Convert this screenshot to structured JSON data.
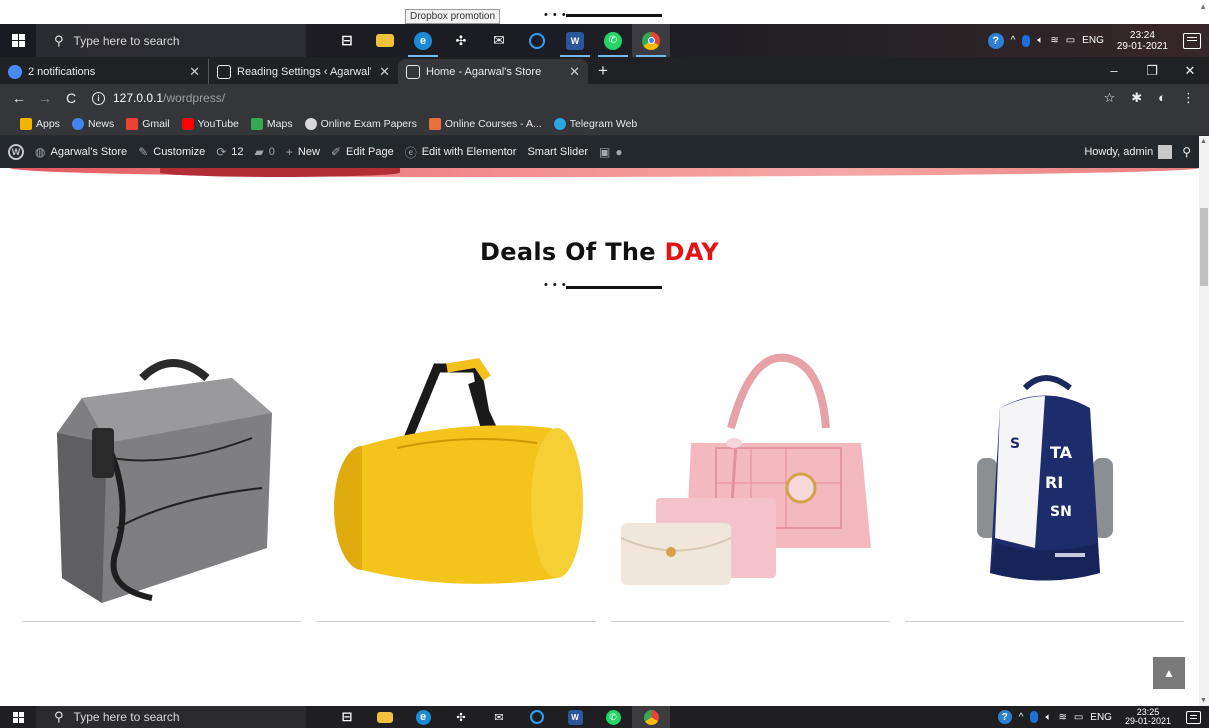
{
  "tooltip": "Dropbox promotion",
  "taskbar_top": {
    "search_placeholder": "Type here to search",
    "lang": "ENG",
    "time": "23:24",
    "date": "29-01-2021"
  },
  "taskbar_bottom": {
    "search_placeholder": "Type here to search",
    "lang": "ENG",
    "time": "23:25",
    "date": "29-01-2021"
  },
  "taskbar_apps": [
    {
      "name": "task-view",
      "glyph": "⧉",
      "color": "transparent"
    },
    {
      "name": "file-explorer",
      "glyph": "▬",
      "color": "#f0c23c"
    },
    {
      "name": "edge",
      "glyph": "e",
      "color": "#1c8bd6"
    },
    {
      "name": "dropbox",
      "glyph": "◆",
      "color": "transparent"
    },
    {
      "name": "mail",
      "glyph": "✉",
      "color": "transparent"
    },
    {
      "name": "cortana",
      "glyph": "○",
      "color": "transparent"
    },
    {
      "name": "word",
      "glyph": "W",
      "color": "#2b579a"
    },
    {
      "name": "whatsapp",
      "glyph": "✆",
      "color": "#25d366"
    },
    {
      "name": "chrome",
      "glyph": "●",
      "color": "#f5b400"
    }
  ],
  "tabs": [
    {
      "title": "2 notifications",
      "fav_color": "#4a8cf7"
    },
    {
      "title": "Reading Settings ‹ Agarwal's Stor",
      "fav_color": "#e8eaed"
    },
    {
      "title": "Home - Agarwal's Store",
      "fav_color": "#e8eaed"
    }
  ],
  "window_controls": {
    "minimize": "–",
    "maximize": "❐",
    "close": "✕"
  },
  "address": {
    "host": "127.0.0.1",
    "path": "/wordpress/"
  },
  "bookmarks": [
    {
      "label": "Apps",
      "color": "#f4b400"
    },
    {
      "label": "News",
      "color": "#4285f4"
    },
    {
      "label": "Gmail",
      "color": "#ea4335"
    },
    {
      "label": "YouTube",
      "color": "#ff0000"
    },
    {
      "label": "Maps",
      "color": "#34a853"
    },
    {
      "label": "Online Exam Papers",
      "color": "#d9d9d9"
    },
    {
      "label": "Online Courses - A...",
      "color": "#e8703a"
    },
    {
      "label": "Telegram Web",
      "color": "#2ca5e0"
    }
  ],
  "wpbar": {
    "site": "Agarwal's Store",
    "customize": "Customize",
    "updates": "12",
    "comments": "0",
    "new": "New",
    "edit_page": "Edit Page",
    "elementor": "Edit with Elementor",
    "slider": "Smart Slider",
    "howdy": "Howdy, admin"
  },
  "section": {
    "title_main": "Deals Of The ",
    "title_highlight": "DAY"
  },
  "products": [
    {
      "name": "grey-laptop-bag",
      "color": "#7a7a7a"
    },
    {
      "name": "yellow-duffel-bag",
      "color": "#f2c21a"
    },
    {
      "name": "pink-handbag-set",
      "color": "#f2b8bd"
    },
    {
      "name": "navy-backpack",
      "color": "#1e2f6b"
    }
  ],
  "colors": {
    "accent": "#e31414",
    "wp_bar": "#23282d",
    "chrome_dark": "#202124"
  }
}
